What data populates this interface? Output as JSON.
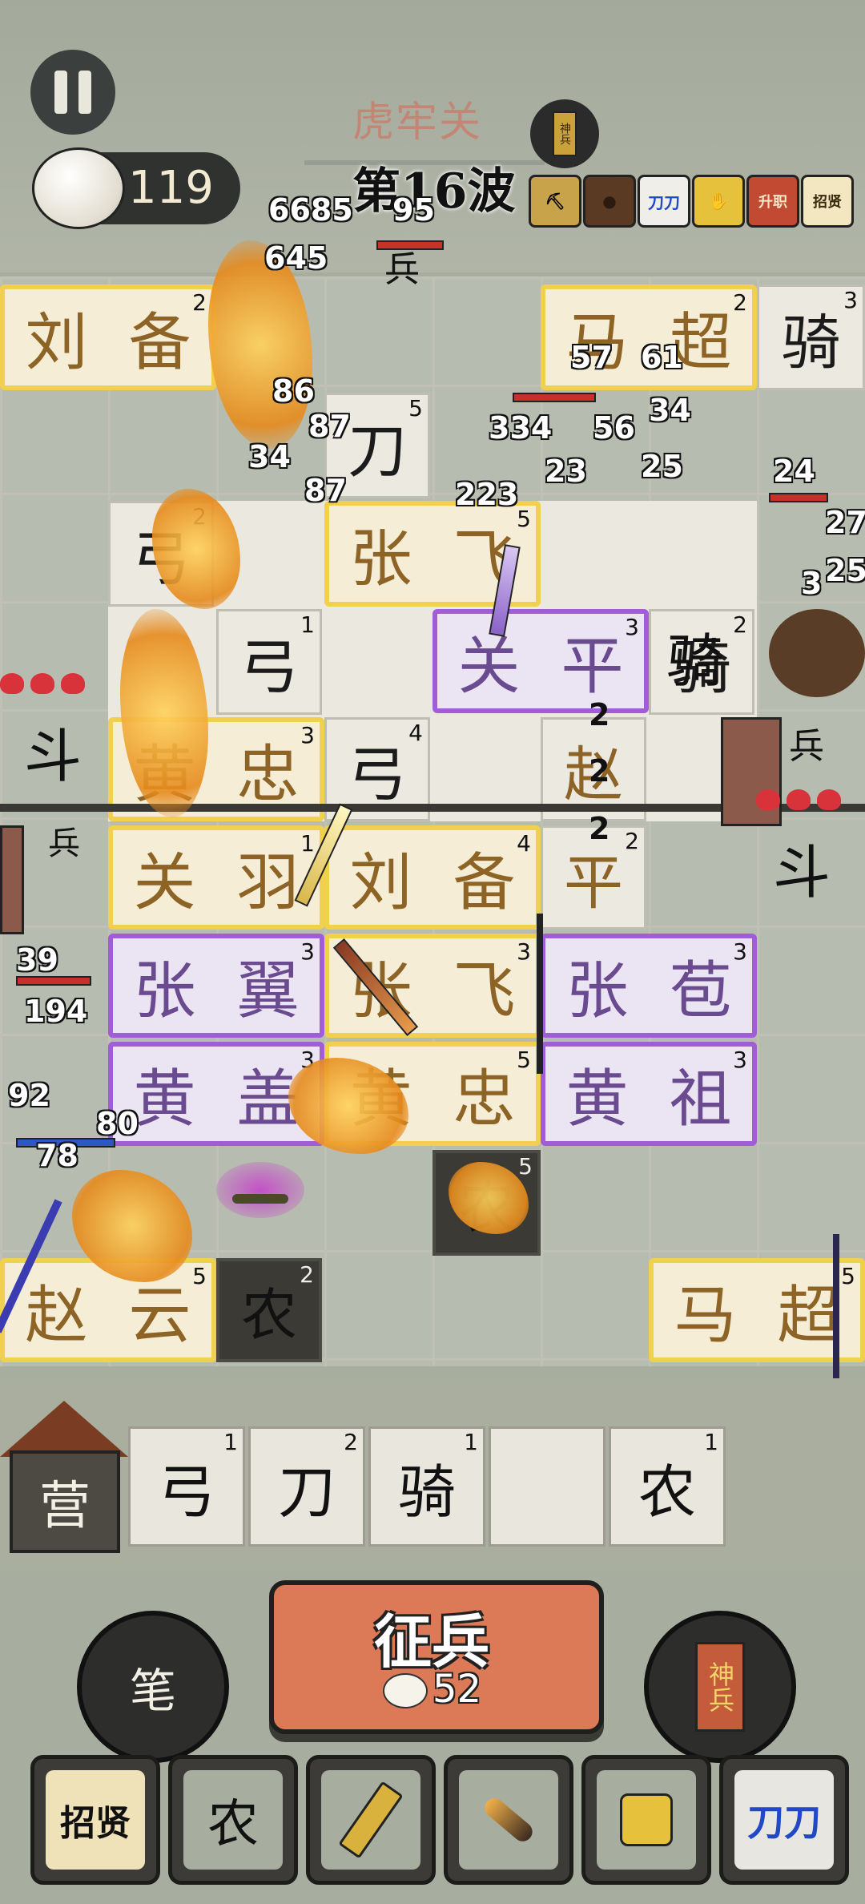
{
  "header": {
    "fortress_name": "虎牢关",
    "resource_count": "119",
    "wave_label": "第16波",
    "token_label": "神兵",
    "buffs": [
      {
        "icon": "shovel-icon",
        "label": ""
      },
      {
        "icon": "cookie-icon",
        "label": ""
      },
      {
        "icon": "double-blade-icon",
        "label": "刀刀"
      },
      {
        "icon": "hand-shovel-icon",
        "label": ""
      },
      {
        "icon": "upgrade-scroll-icon",
        "label": "升职"
      },
      {
        "icon": "recruit-scroll-icon",
        "label": "招贤"
      }
    ]
  },
  "board": {
    "units": [
      {
        "id": "liubei-top",
        "type": "gold",
        "name1": "刘",
        "name2": "备",
        "level": "2"
      },
      {
        "id": "machao-top",
        "type": "gold",
        "name1": "马",
        "name2": "超",
        "level": "2"
      },
      {
        "id": "zhangfei-mid",
        "type": "gold",
        "name1": "张",
        "name2": "飞",
        "level": "5"
      },
      {
        "id": "guanping-purple",
        "type": "purple",
        "name1": "关",
        "name2": "平",
        "level": "3"
      },
      {
        "id": "huangzhong",
        "type": "gold",
        "name1": "黄",
        "name2": "忠",
        "level": "3"
      },
      {
        "id": "guanyu",
        "type": "gold",
        "name1": "关",
        "name2": "羽",
        "level": "1"
      },
      {
        "id": "liubei-mid",
        "type": "gold",
        "name1": "刘",
        "name2": "备",
        "level": "4"
      },
      {
        "id": "zhangyi",
        "type": "purple",
        "name1": "张",
        "name2": "翼",
        "level": "3"
      },
      {
        "id": "zhangfei-low",
        "type": "gold",
        "name1": "张",
        "name2": "飞",
        "level": "3"
      },
      {
        "id": "zhangbao",
        "type": "purple",
        "name1": "张",
        "name2": "苞",
        "level": "3"
      },
      {
        "id": "huanggai",
        "type": "purple",
        "name1": "黄",
        "name2": "盖",
        "level": "3"
      },
      {
        "id": "huangzhong-low",
        "type": "gold",
        "name1": "黄",
        "name2": "忠",
        "level": "5"
      },
      {
        "id": "huangzu",
        "type": "purple",
        "name1": "黄",
        "name2": "祖",
        "level": "3"
      },
      {
        "id": "zhaoyun",
        "type": "gold",
        "name1": "赵",
        "name2": "云",
        "level": "5"
      },
      {
        "id": "machao-low",
        "type": "gold",
        "name1": "马",
        "name2": "超",
        "level": "5"
      }
    ],
    "plain_units": [
      {
        "label": "刀",
        "level": "5"
      },
      {
        "label": "弓",
        "level": "2"
      },
      {
        "label": "骑",
        "level": "3"
      },
      {
        "label": "骑",
        "level": "2"
      },
      {
        "label": "弓",
        "level": "4"
      },
      {
        "label": "赵",
        "level": ""
      },
      {
        "label": "平",
        "level": "2"
      },
      {
        "label": "弓",
        "level": "1"
      },
      {
        "label": "农",
        "level": "5"
      },
      {
        "label": "农",
        "level": "2"
      }
    ],
    "enemies": [
      {
        "label": "斗"
      },
      {
        "label": "兵"
      },
      {
        "label": "兵"
      },
      {
        "label": "斗"
      },
      {
        "label": "骑"
      },
      {
        "label": "兵"
      }
    ],
    "damage_numbers": [
      "6685",
      "645",
      "87",
      "95",
      "86",
      "34",
      "87",
      "57",
      "61",
      "334",
      "56",
      "34",
      "23",
      "223",
      "25",
      "24",
      "27",
      "25",
      "39",
      "194",
      "92",
      "80",
      "78",
      "3"
    ],
    "side_numbers": [
      "2",
      "2",
      "2"
    ]
  },
  "camp": {
    "label": "营",
    "slots": [
      {
        "label": "弓",
        "level": "1"
      },
      {
        "label": "刀",
        "level": "2"
      },
      {
        "label": "骑",
        "level": "1"
      },
      {
        "label": "",
        "level": ""
      },
      {
        "label": "农",
        "level": "1"
      }
    ]
  },
  "controls": {
    "brush_label": "笔",
    "recruit_title": "征兵",
    "recruit_cost": "52",
    "divine_label": "神兵"
  },
  "skills": [
    {
      "icon": "recruit-scroll-icon",
      "label": "招贤"
    },
    {
      "icon": "farmer-icon",
      "label": "农"
    },
    {
      "icon": "shovel-icon",
      "label": ""
    },
    {
      "icon": "meteor-icon",
      "label": ""
    },
    {
      "icon": "dig-treasure-icon",
      "label": ""
    },
    {
      "icon": "double-blade-icon",
      "label": "刀刀"
    }
  ],
  "colors": {
    "gold_border": "#f0d04c",
    "purple_border": "#a05dd7",
    "recruit_button": "#dc7a58",
    "background": "#a8ae9f"
  }
}
